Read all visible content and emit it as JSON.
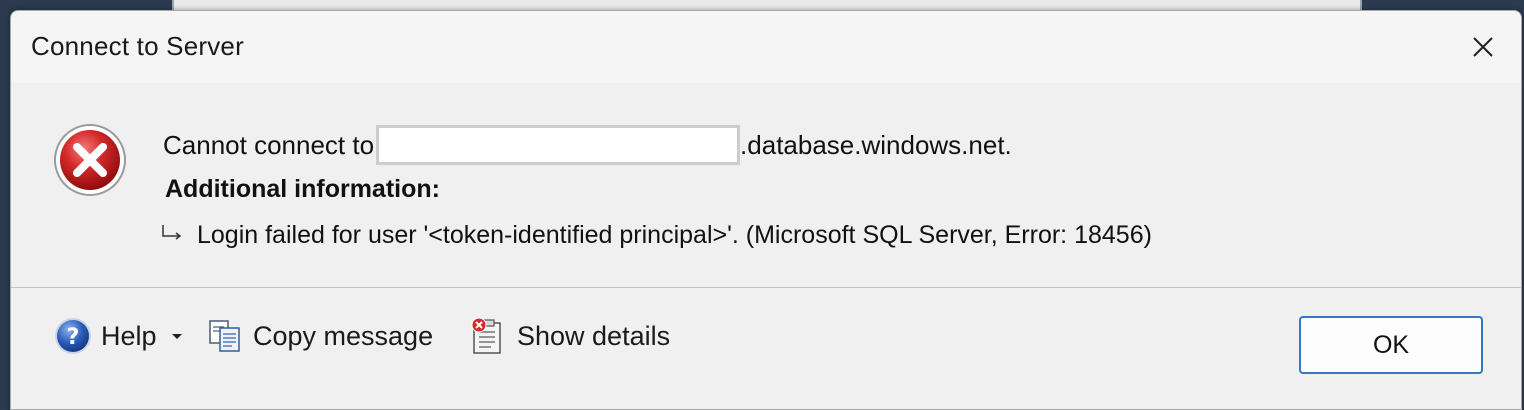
{
  "dialog": {
    "title": "Connect to Server",
    "close_icon": "close-icon"
  },
  "message": {
    "icon": "error-icon",
    "prefix": "Cannot connect to",
    "server_name_value": "",
    "suffix": ".database.windows.net.",
    "additional_heading": "Additional information:",
    "detail_icon": "indent-arrow-icon",
    "detail": "Login failed for user '<token-identified principal>'. (Microsoft SQL Server, Error: 18456)"
  },
  "footer": {
    "help_label": "Help",
    "copy_label": "Copy message",
    "details_label": "Show details",
    "ok_label": "OK"
  },
  "colors": {
    "error_red": "#c8171c",
    "ok_border": "#2f79c6",
    "help_blue": "#2a5cb8"
  }
}
